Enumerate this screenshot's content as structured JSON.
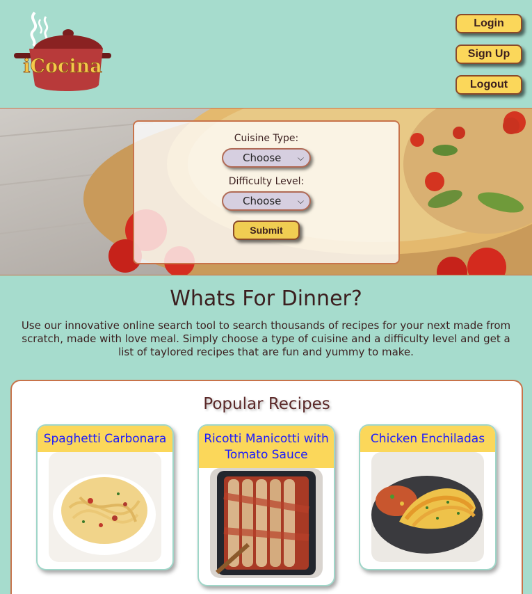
{
  "header": {
    "logo_text": "iCocina",
    "buttons": {
      "login": "Login",
      "signup": "Sign Up",
      "logout": "Logout"
    }
  },
  "search": {
    "cuisine_label": "Cuisine Type:",
    "cuisine_value": "Choose",
    "difficulty_label": "Difficulty Level:",
    "difficulty_value": "Choose",
    "submit": "Submit"
  },
  "intro": {
    "title": "Whats For Dinner?",
    "text": "Use our innovative online search tool to search thousands of recipes for your next made from scratch, made with love meal. Simply choose a type of cuisine and a difficulty level and get a list of taylored recipes that are fun and yummy to make."
  },
  "popular": {
    "title": "Popular Recipes",
    "recipes": [
      {
        "name": "Spaghetti Carbonara"
      },
      {
        "name": "Ricotti Manicotti with Tomato Sauce"
      },
      {
        "name": "Chicken Enchiladas"
      }
    ]
  },
  "colors": {
    "background": "#a6dccd",
    "button": "#fbd75a",
    "accent_border": "#c8734a",
    "link": "#1a1aff"
  }
}
